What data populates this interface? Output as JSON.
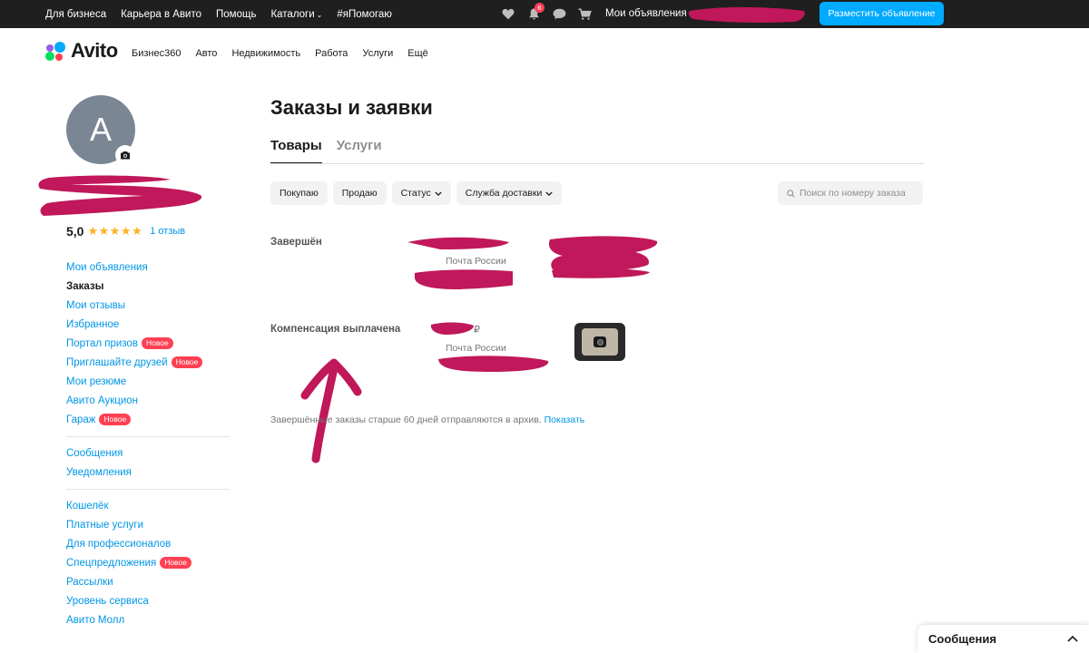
{
  "topbar": {
    "links": [
      {
        "label": "Для бизнеса"
      },
      {
        "label": "Карьера в Авито"
      },
      {
        "label": "Помощь"
      },
      {
        "label": "Каталоги",
        "dropdown": true
      },
      {
        "label": "#яПомогаю"
      }
    ],
    "notifications_count": "6",
    "my_ads": "Мои объявления",
    "post_button": "Разместить объявление"
  },
  "logo": {
    "text": "Avito"
  },
  "categories": [
    "Бизнес360",
    "Авто",
    "Недвижимость",
    "Работа",
    "Услуги",
    "Ещё"
  ],
  "profile": {
    "avatar_letter": "A",
    "rating": "5,0",
    "stars": "★★★★★",
    "reviews": "1 отзыв"
  },
  "sidebar": {
    "group1": [
      {
        "label": "Мои объявления"
      },
      {
        "label": "Заказы",
        "active": true
      },
      {
        "label": "Мои отзывы"
      },
      {
        "label": "Избранное"
      },
      {
        "label": "Портал призов",
        "badge": "Новое"
      },
      {
        "label": "Приглашайте друзей",
        "badge": "Новое"
      },
      {
        "label": "Мои резюме"
      },
      {
        "label": "Авито Аукцион"
      },
      {
        "label": "Гараж",
        "badge": "Новое"
      }
    ],
    "group2": [
      {
        "label": "Сообщения"
      },
      {
        "label": "Уведомления"
      }
    ],
    "group3": [
      {
        "label": "Кошелёк"
      },
      {
        "label": "Платные услуги"
      },
      {
        "label": "Для профессионалов"
      },
      {
        "label": "Спецпредложения",
        "badge": "Новое"
      },
      {
        "label": "Рассылки"
      },
      {
        "label": "Уровень сервиса"
      },
      {
        "label": "Авито Молл"
      }
    ]
  },
  "main": {
    "title": "Заказы и заявки",
    "tabs": [
      {
        "label": "Товары",
        "active": true
      },
      {
        "label": "Услуги",
        "active": false
      }
    ],
    "filters": [
      {
        "label": "Покупаю"
      },
      {
        "label": "Продаю"
      },
      {
        "label": "Статус",
        "dropdown": true
      },
      {
        "label": "Служба доставки",
        "dropdown": true
      }
    ],
    "search_placeholder": "Поиск по номеру заказа",
    "orders": [
      {
        "status": "Завершён",
        "delivery": "Почта России"
      },
      {
        "status": "Компенсация выплачена",
        "price_suffix": "₽",
        "delivery": "Почта России"
      }
    ],
    "archive_note": "Завершённые заказы старше 60 дней отправляются в архив.",
    "archive_link": "Показать"
  },
  "messages_widget": {
    "label": "Сообщения"
  },
  "colors": {
    "topbar": "#1f1f1f",
    "accent_blue": "#00aaff",
    "link_blue": "#0096e6",
    "badge_red": "#ff4053",
    "star": "#ffb021",
    "redaction": "#c0185a"
  }
}
